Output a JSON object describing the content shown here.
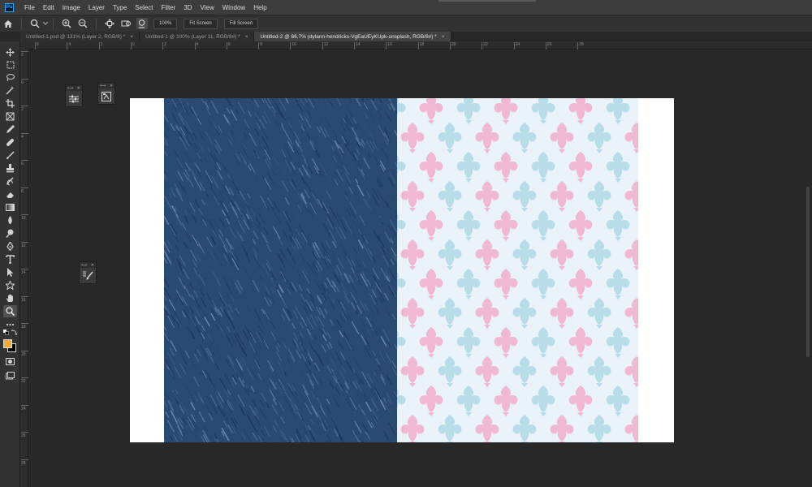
{
  "app": {
    "logo_text": "Ps"
  },
  "menu": [
    "File",
    "Edit",
    "Image",
    "Layer",
    "Type",
    "Select",
    "Filter",
    "3D",
    "View",
    "Window",
    "Help"
  ],
  "options": {
    "zoom_value": "100%",
    "fit_screen_label": "Fit Screen",
    "fill_screen_label": "Fill Screen"
  },
  "tabs": [
    {
      "label": "Untitled-1.psd @ 131% (Layer 2, RGB/8) *",
      "active": false
    },
    {
      "label": "Untitled-1 @ 100% (Layer 11, RGB/8#) *",
      "active": false
    },
    {
      "label": "Untitled-2 @ 66.7% (dylann-hendricks-VgEaUEyKUpk-unsplash, RGB/8#) *",
      "active": true
    }
  ],
  "tab_close_glyph": "×",
  "ruler_top_labels": [
    "6",
    "4",
    "2",
    "0",
    "2",
    "4",
    "6",
    "8",
    "10",
    "12",
    "14",
    "16",
    "18",
    "20",
    "22",
    "24",
    "26",
    "28"
  ],
  "ruler_left_labels": [
    "2",
    "0",
    "2",
    "4",
    "6",
    "8",
    "10",
    "12",
    "14",
    "16",
    "18",
    "20",
    "22",
    "24",
    "26",
    "28"
  ],
  "colors": {
    "foreground": "#f3ad38",
    "background": "#000000",
    "denim": "#2a4a72",
    "damask_pink": "#f0b8d2",
    "damask_blue": "#b6dde8"
  },
  "icons": {
    "home": "home-icon",
    "zoom": "zoom-tool-icon",
    "zoom_in": "zoom-in-icon",
    "zoom_out": "zoom-out-icon"
  }
}
